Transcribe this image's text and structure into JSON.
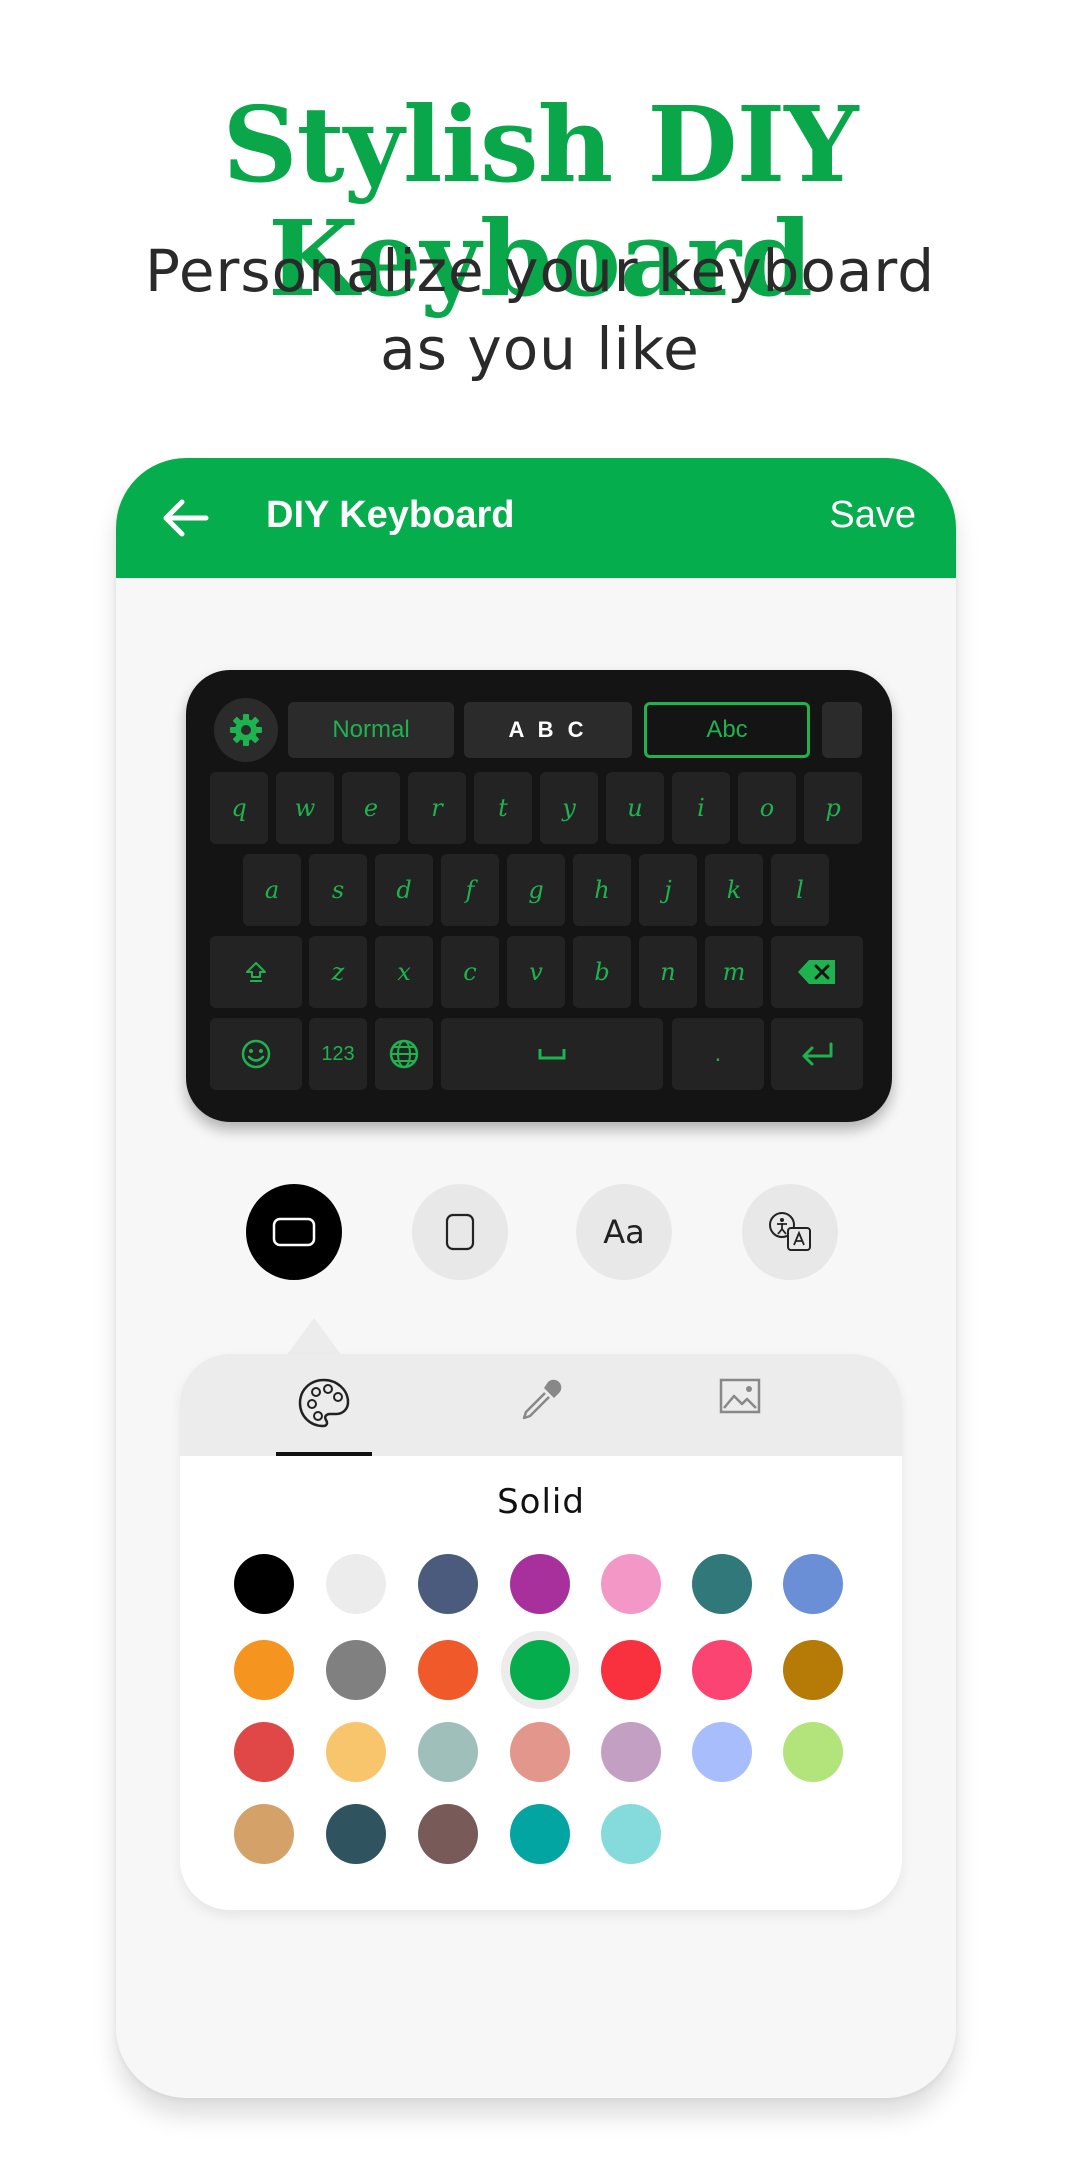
{
  "promo": {
    "headline": "Stylish DIY Keyboard",
    "sub_line1": "Personalize your keyboard",
    "sub_line2": "as you like"
  },
  "appbar": {
    "title": "DIY Keyboard",
    "save_label": "Save",
    "back_icon": "arrow-left-icon",
    "color": "#06ad4d"
  },
  "keyboard": {
    "accent_color": "#1fb34f",
    "background": "#141414",
    "settings_icon": "gear-icon",
    "font_chips": [
      "Normal",
      "A B C",
      "Abc"
    ],
    "row1": [
      "q",
      "w",
      "e",
      "r",
      "t",
      "y",
      "u",
      "i",
      "o",
      "p"
    ],
    "row2": [
      "a",
      "s",
      "d",
      "f",
      "g",
      "h",
      "j",
      "k",
      "l"
    ],
    "row3": [
      "z",
      "x",
      "c",
      "v",
      "b",
      "n",
      "m"
    ],
    "shift_icon": "shift-icon",
    "backspace_icon": "backspace-icon",
    "emoji_icon": "emoji-icon",
    "numbers_label": "123",
    "globe_icon": "globe-icon",
    "space_icon": "space-icon",
    "period_label": ".",
    "enter_icon": "enter-icon"
  },
  "tools": [
    {
      "name": "keyboard-background-tool",
      "icon": "rounded-rect-landscape-icon",
      "active": true
    },
    {
      "name": "key-shape-tool",
      "icon": "rounded-rect-portrait-icon",
      "active": false
    },
    {
      "name": "font-tool",
      "label": "Aa",
      "active": false
    },
    {
      "name": "language-tool",
      "icon": "translate-icon",
      "active": false
    }
  ],
  "sheet": {
    "tabs": [
      "palette-icon",
      "eyedropper-icon",
      "image-icon"
    ],
    "active_tab": 0,
    "heading": "Solid",
    "colors": [
      "#000000",
      "#ececec",
      "#4b5b7e",
      "#a8309c",
      "#f397c7",
      "#31787a",
      "#6a8fd6",
      "#f5941f",
      "#808080",
      "#f05a2a",
      "#06ad4d",
      "#f9313e",
      "#fb4471",
      "#b67a06",
      "#e04848",
      "#f9c56c",
      "#9fbfbb",
      "#e3968b",
      "#c3a0c3",
      "#a8bdfb",
      "#b3e47c",
      "#d4a168",
      "#2f535f",
      "#785a58",
      "#02a5a1",
      "#85dadc"
    ],
    "selected_color_index": 10
  }
}
